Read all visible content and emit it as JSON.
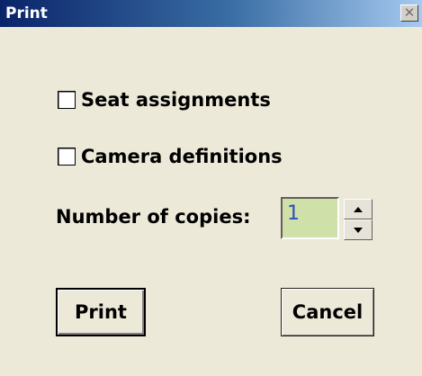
{
  "window": {
    "title": "Print",
    "close_glyph": "✕"
  },
  "options": {
    "seat_assignments": {
      "label": "Seat assignments",
      "checked": false
    },
    "camera_definitions": {
      "label": "Camera definitions",
      "checked": false
    }
  },
  "copies": {
    "label": "Number of copies:",
    "value": "1",
    "field_color": "#cfe0a8"
  },
  "buttons": {
    "print_label": "Print",
    "cancel_label": "Cancel"
  },
  "colors": {
    "titlebar_start": "#0a246a",
    "titlebar_end": "#a6caf0",
    "dialog_bg": "#ece9d8",
    "copies_text": "#2a4fbf"
  }
}
